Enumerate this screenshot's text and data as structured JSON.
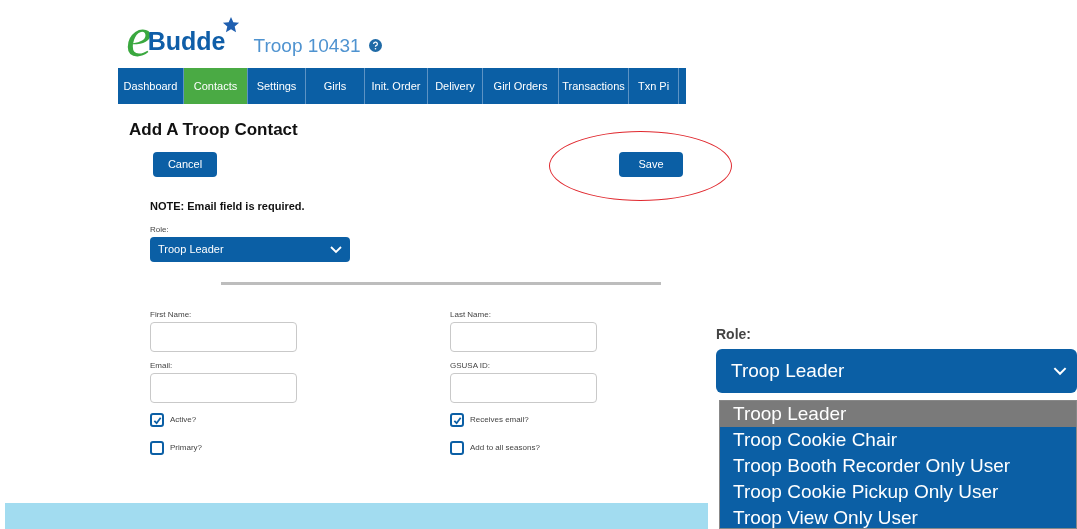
{
  "logo": {
    "letter": "e",
    "word": "Budde"
  },
  "troop": {
    "title": "Troop 10431"
  },
  "nav": [
    {
      "label": "Dashboard",
      "selected": false
    },
    {
      "label": "Contacts",
      "selected": true
    },
    {
      "label": "Settings",
      "selected": false
    },
    {
      "label": "Girls",
      "selected": false
    },
    {
      "label": "Init. Order",
      "selected": false
    },
    {
      "label": "Delivery",
      "selected": false
    },
    {
      "label": "Girl Orders",
      "selected": false
    },
    {
      "label": "Transactions",
      "selected": false
    },
    {
      "label": "Txn Pi",
      "selected": false
    }
  ],
  "form": {
    "title": "Add A Troop Contact",
    "cancel": "Cancel",
    "save": "Save",
    "note": "NOTE: Email field is required.",
    "role_label": "Role:",
    "role_value": "Troop Leader",
    "fields": [
      {
        "label": "First Name:"
      },
      {
        "label": "Last Name:"
      },
      {
        "label": "Email:"
      },
      {
        "label": "GSUSA ID:"
      }
    ],
    "checkboxes": [
      {
        "label": "Active?",
        "checked": true
      },
      {
        "label": "Receives email?",
        "checked": true
      },
      {
        "label": "Primary?",
        "checked": false
      },
      {
        "label": "Add to all seasons?",
        "checked": false
      }
    ]
  },
  "inset": {
    "role_label": "Role:",
    "role_value": "Troop Leader",
    "options": [
      {
        "label": "Troop Leader",
        "selected": true
      },
      {
        "label": "Troop Cookie Chair",
        "selected": false
      },
      {
        "label": "Troop Booth Recorder Only User",
        "selected": false
      },
      {
        "label": "Troop Cookie Pickup Only User",
        "selected": false
      },
      {
        "label": "Troop View Only User",
        "selected": false
      }
    ]
  }
}
